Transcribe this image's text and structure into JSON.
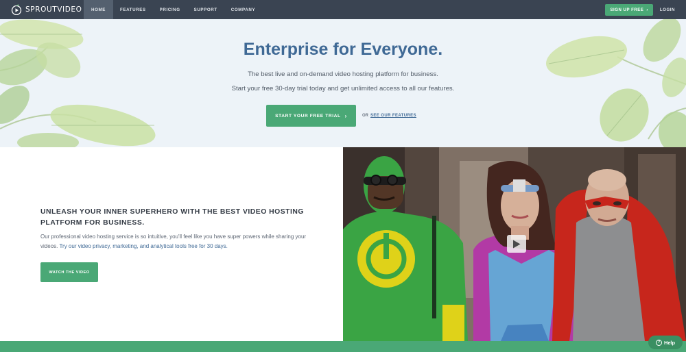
{
  "nav": {
    "logo_text": "SPROUTVIDEO",
    "links": [
      {
        "label": "HOME",
        "active": true
      },
      {
        "label": "FEATURES",
        "active": false
      },
      {
        "label": "PRICING",
        "active": false
      },
      {
        "label": "SUPPORT",
        "active": false
      },
      {
        "label": "COMPANY",
        "active": false
      }
    ],
    "signup_label": "SIGN UP FREE",
    "signup_chevron": "›",
    "login_label": "LOGIN"
  },
  "hero": {
    "title": "Enterprise for Everyone.",
    "line1": "The best live and on-demand video hosting platform for business.",
    "line2": "Start your free 30-day trial today and get unlimited access to all our features.",
    "trial_button": "START YOUR FREE TRIAL",
    "trial_chevron": "›",
    "or_text": "OR",
    "features_link": "SEE OUR FEATURES"
  },
  "superhero": {
    "heading": "UNLEASH YOUR INNER SUPERHERO WITH THE BEST VIDEO HOSTING PLATFORM FOR BUSINESS.",
    "body_text": "Our professional video hosting service is so intuitive, you'll feel like you have super powers while sharing your videos. ",
    "body_link": "Try our video privacy, marketing, and analytical tools free for 30 days.",
    "watch_button": "WATCH THE VIDEO"
  },
  "help": {
    "label": "Help",
    "icon_glyph": "?"
  },
  "icons": {
    "logo": "sprout-play-icon",
    "play": "play-icon",
    "help": "question-circle-icon"
  },
  "colors": {
    "nav_bg": "#3a4452",
    "accent_green": "#4aa876",
    "hero_bg": "#edf3f8",
    "title_blue": "#3f6995"
  }
}
